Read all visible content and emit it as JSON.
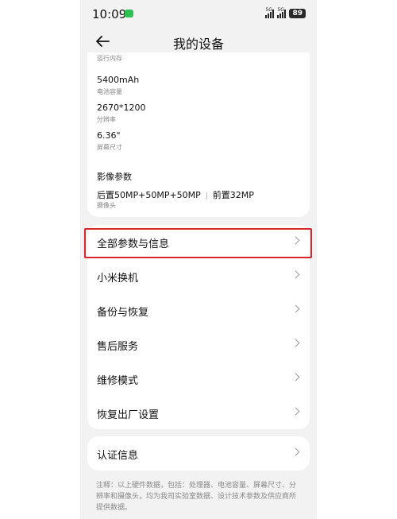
{
  "status_bar": {
    "time": "10:09",
    "signal_1": "5G",
    "signal_2": "5G",
    "battery": "89"
  },
  "nav": {
    "title": "我的设备"
  },
  "specs": {
    "partial_label": "运行内存",
    "items": [
      {
        "value": "5400mAh",
        "label": "电池容量"
      },
      {
        "value": "2670*1200",
        "label": "分辨率"
      },
      {
        "value": "6.36\"",
        "label": "屏幕尺寸"
      }
    ],
    "camera": {
      "title": "影像参数",
      "rear": "后置50MP+50MP+50MP",
      "front": "前置32MP",
      "label": "摄像头"
    }
  },
  "menu": [
    {
      "label": "全部参数与信息"
    },
    {
      "label": "小米换机"
    },
    {
      "label": "备份与恢复"
    },
    {
      "label": "售后服务"
    },
    {
      "label": "维修模式"
    },
    {
      "label": "恢复出厂设置"
    }
  ],
  "cert": {
    "label": "认证信息"
  },
  "footnote": "注释：以上硬件数据，包括：处理器、电池容量、屏幕尺寸、分辨率和摄像头，均为我司实验室数据、设计技术参数及供应商所提供数据。"
}
